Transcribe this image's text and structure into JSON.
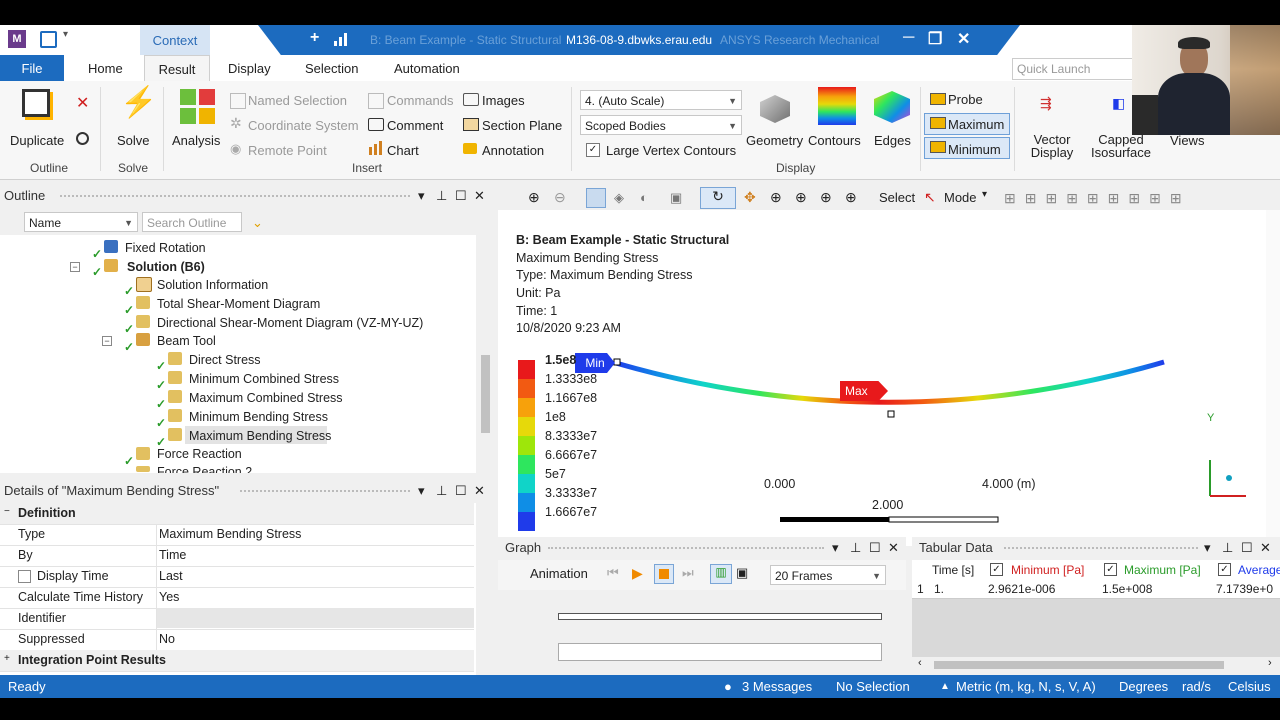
{
  "window": {
    "app_icon": "M",
    "context_label": "Context",
    "title": "M136-08-9.dbwks.erau.edu",
    "title_left_blur": "B: Beam Example - Static Structural",
    "title_right_blur": "ANSYS Research Mechanical",
    "controls": [
      "+",
      "▯",
      "─",
      "❐",
      "✕"
    ]
  },
  "tabs": [
    "File",
    "Home",
    "Result",
    "Display",
    "Selection",
    "Automation"
  ],
  "quick_launch_placeholder": "Quick Launch",
  "ribbon": {
    "outline_group": {
      "duplicate": "Duplicate",
      "group": "Outline"
    },
    "solve_group": {
      "solve": "Solve",
      "group": "Solve"
    },
    "insert_group": {
      "analysis": "Analysis",
      "named_selection": "Named Selection",
      "coordinate_system": "Coordinate System",
      "remote_point": "Remote Point",
      "commands": "Commands",
      "comment": "Comment",
      "chart": "Chart",
      "images": "Images",
      "section_plane": "Section Plane",
      "annotation": "Annotation",
      "group": "Insert"
    },
    "display_group": {
      "scale": "4. (Auto Scale)",
      "scoped": "Scoped Bodies",
      "large_vertex": "Large Vertex Contours",
      "geometry": "Geometry",
      "contours": "Contours",
      "edges": "Edges",
      "group": "Display"
    },
    "probe": "Probe",
    "maximum": "Maximum",
    "minimum": "Minimum",
    "vector_display": "Vector Display",
    "capped_isosurface": "Capped Isosurface",
    "views": "Views"
  },
  "outline": {
    "title": "Outline",
    "filter_label": "Name",
    "search_placeholder": "Search Outline",
    "items": [
      "Fixed Rotation",
      "Solution (B6)",
      "Solution Information",
      "Total Shear-Moment Diagram",
      "Directional Shear-Moment Diagram (VZ-MY-UZ)",
      "Beam Tool",
      "Direct Stress",
      "Minimum Combined Stress",
      "Maximum Combined Stress",
      "Minimum Bending Stress",
      "Maximum Bending Stress",
      "Force Reaction",
      "Force Reaction 2"
    ]
  },
  "details": {
    "title": "Details of \"Maximum Bending Stress\"",
    "section_definition": "Definition",
    "rows": [
      {
        "k": "Type",
        "v": "Maximum Bending Stress"
      },
      {
        "k": "By",
        "v": "Time"
      },
      {
        "k": "Display Time",
        "v": "Last"
      },
      {
        "k": "Calculate Time History",
        "v": "Yes"
      },
      {
        "k": "Identifier",
        "v": ""
      },
      {
        "k": "Suppressed",
        "v": "No"
      }
    ],
    "section_integration": "Integration Point Results"
  },
  "viewport": {
    "select_label": "Select",
    "mode_label": "Mode",
    "header": "B: Beam Example - Static Structural",
    "result_name": "Maximum Bending Stress",
    "type_line": "Type: Maximum Bending Stress",
    "unit_line": "Unit: Pa",
    "time_line": "Time: 1",
    "date_line": "10/8/2020 9:23 AM",
    "legend": [
      {
        "label": "1.5e8",
        "color": "#e8191b"
      },
      {
        "label": "1.3333e8",
        "color": "#f25a12"
      },
      {
        "label": "1.1667e8",
        "color": "#f7a10b"
      },
      {
        "label": "1e8",
        "color": "#e6d90a"
      },
      {
        "label": "8.3333e7",
        "color": "#9ee60a"
      },
      {
        "label": "6.6667e7",
        "color": "#2ee65e"
      },
      {
        "label": "5e7",
        "color": "#10d4c8"
      },
      {
        "label": "3.3333e7",
        "color": "#0f8ee6"
      },
      {
        "label": "1.6667e7",
        "color": "#1f3bea"
      }
    ],
    "min_tag": "Min",
    "max_tag": "Max",
    "scale_left": "0.000",
    "scale_right": "4.000 (m)",
    "scale_mid": "2.000",
    "axis_y": "Y"
  },
  "graph": {
    "title": "Graph",
    "animation_label": "Animation",
    "frames": "20 Frames"
  },
  "tabular": {
    "title": "Tabular Data",
    "columns": [
      "Time [s]",
      "Minimum [Pa]",
      "Maximum [Pa]",
      "Average"
    ],
    "rows": [
      {
        "idx": "1",
        "time": "1.",
        "min": "2.9621e-006",
        "max": "1.5e+008",
        "avg": "7.1739e+0"
      }
    ]
  },
  "status": {
    "ready": "Ready",
    "messages": "3 Messages",
    "selection": "No Selection",
    "units": "Metric (m, kg, N, s, V, A)",
    "degrees": "Degrees",
    "rads": "rad/s",
    "celsius": "Celsius"
  },
  "colors": {
    "accent": "#1c6bbf",
    "min_tag": "#1f3bea",
    "max_tag": "#e8191b"
  }
}
